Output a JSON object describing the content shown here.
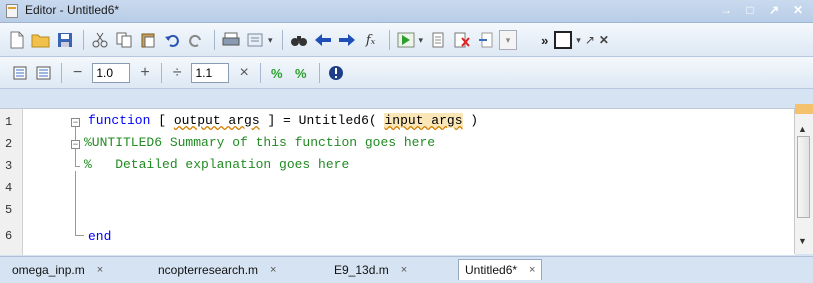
{
  "window": {
    "title": "Editor - Untitled6*"
  },
  "toolbar2": {
    "minus": "−",
    "value1": "1.0",
    "plus": "+",
    "divide": "÷",
    "value2": "1.1",
    "times": "×"
  },
  "editor": {
    "line_numbers": [
      "1",
      "2",
      "3",
      "4",
      "5",
      "6"
    ],
    "line1": {
      "kw": "function",
      "a": " [ ",
      "out": "output args",
      "b": " ] = Untitled6( ",
      "in": "input args",
      "c": " )"
    },
    "line2": "%UNTITLED6 Summary of this function goes here",
    "line3": "%   Detailed explanation goes here",
    "line6": "end"
  },
  "tabs": [
    {
      "label": "omega_inp.m",
      "close": "×"
    },
    {
      "label": "ncopterresearch.m",
      "close": "×"
    },
    {
      "label": "E9_13d.m",
      "close": "×"
    },
    {
      "label": "Untitled6*",
      "close": "×"
    }
  ],
  "colors": {
    "keyword": "#0000ff",
    "comment": "#228b22",
    "highlight": "#fbe6b8"
  }
}
